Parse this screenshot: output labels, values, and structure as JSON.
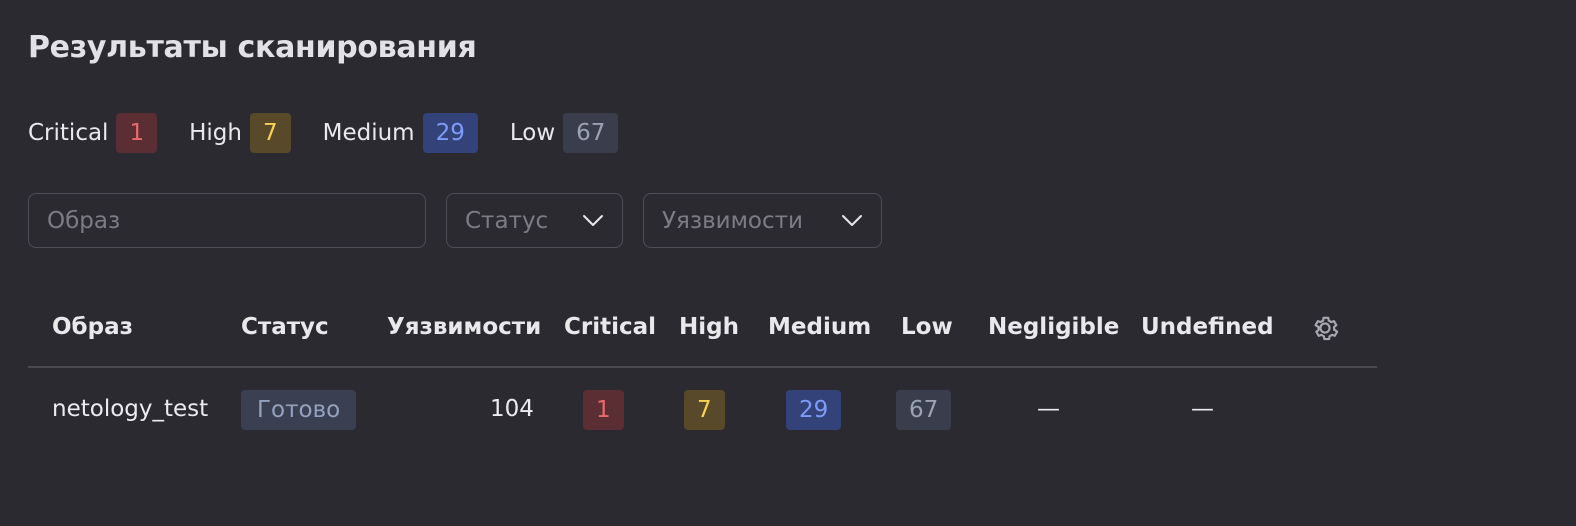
{
  "page": {
    "title": "Результаты сканирования"
  },
  "summary": {
    "critical": {
      "label": "Critical",
      "count": "1"
    },
    "high": {
      "label": "High",
      "count": "7"
    },
    "medium": {
      "label": "Medium",
      "count": "29"
    },
    "low": {
      "label": "Low",
      "count": "67"
    }
  },
  "filters": {
    "image_placeholder": "Образ",
    "status_placeholder": "Статус",
    "vuln_placeholder": "Уязвимости"
  },
  "table": {
    "columns": {
      "image": "Образ",
      "status": "Статус",
      "vulns": "Уязвимости",
      "critical": "Critical",
      "high": "High",
      "medium": "Medium",
      "low": "Low",
      "negligible": "Negligible",
      "undefined": "Undefined"
    },
    "rows": [
      {
        "image": "netology_test",
        "status": "Готово",
        "vulns": "104",
        "critical": "1",
        "high": "7",
        "medium": "29",
        "low": "67",
        "negligible": "—",
        "undefined": "—"
      }
    ]
  },
  "icons": {
    "settings": "gear-icon",
    "dropdown": "chevron-down-icon"
  },
  "colors": {
    "background": "#2b2a31",
    "critical": "#e86a6f",
    "high": "#f6d353",
    "medium": "#7e9bf7",
    "low": "#9aa3b4"
  }
}
